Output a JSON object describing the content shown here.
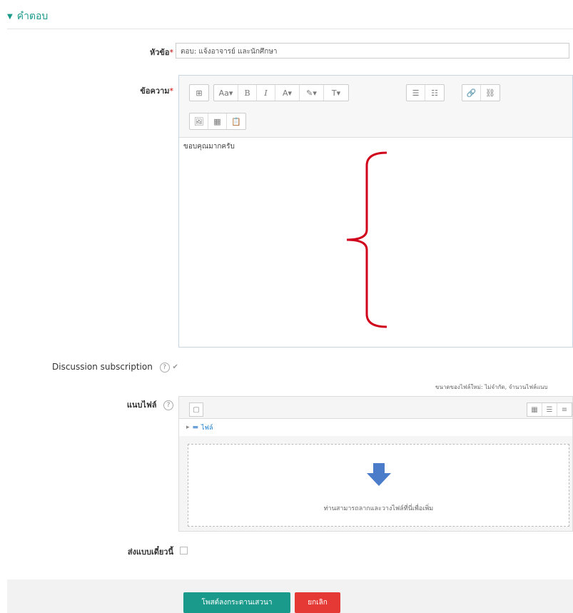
{
  "section": {
    "title": "คำตอบ"
  },
  "subject": {
    "label": "หัวข้อ",
    "value": "ตอบ: แจ้งอาจารย์ และนักศึกษา"
  },
  "message": {
    "label": "ข้อความ",
    "content": "ขอบคุณมากครับ",
    "toolbar_row1": [
      "⊞",
      "Aa▾",
      "B",
      "I",
      "A▾",
      "✎▾",
      "T▾",
      "☰",
      "☷",
      "🔗",
      "⛓"
    ],
    "toolbar_row2": [
      "🖼",
      "▦",
      "📋"
    ]
  },
  "subscription": {
    "label": "Discussion subscription"
  },
  "attachment": {
    "label": "แนบไฟล์",
    "max_size": "ขนาดของไฟล์ใหม่: ไม่จำกัด, จำนวนไฟล์แนบ",
    "folder": "ไฟล์",
    "drop_hint": "ท่านสามารถลากและวางไฟล์ที่นี่เพื่อเพิ่ม"
  },
  "mailnow": {
    "label": "ส่งแบบเดี๋ยวนี้"
  },
  "buttons": {
    "submit": "โพสต์ลงกระดานเสวนา",
    "cancel": "ยกเลิก"
  },
  "colors": {
    "accent": "#1a9a8a",
    "cancel": "#e53935",
    "annotation": "#d0021b"
  }
}
